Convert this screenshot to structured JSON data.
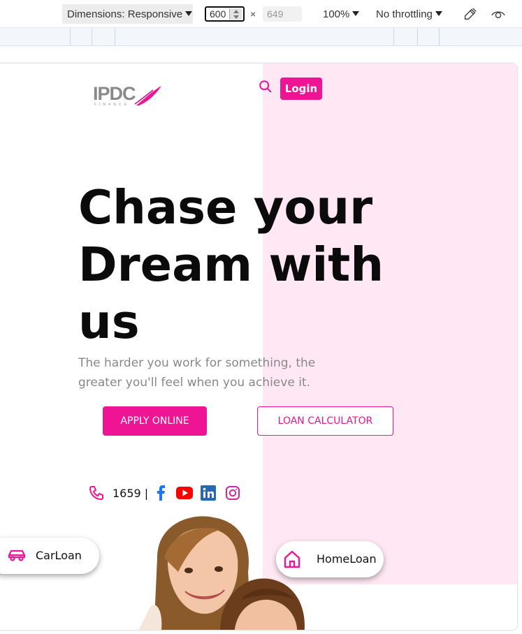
{
  "devtools": {
    "dimensions_label": "Dimensions: Responsive",
    "width_value": "600",
    "times": "×",
    "height_placeholder": "649",
    "zoom": "100%",
    "throttling": "No throttling"
  },
  "site": {
    "logo_text": "IPDC",
    "logo_sub": "FINANCE",
    "login_label": "Login",
    "hero_title": "Chase your Dream with us",
    "hero_subtitle": "The harder you work for something, the greater you'll feel when you achieve it.",
    "apply_label": "APPLY ONLINE",
    "calculator_label": "LOAN CALCULATOR",
    "hotline": "1659 |",
    "carloan_label": "CarLoan",
    "homeloan_label": "HomeLoan"
  },
  "colors": {
    "accent": "#ee1494",
    "pink_panel": "#ffe8f3",
    "facebook": "#1877f2",
    "youtube": "#ff0000",
    "linkedin": "#2867b2"
  },
  "icons": [
    "search-icon",
    "phone-icon",
    "facebook-icon",
    "youtube-icon",
    "linkedin-icon",
    "instagram-icon",
    "car-icon",
    "home-icon",
    "color-picker-icon",
    "eye-icon"
  ]
}
